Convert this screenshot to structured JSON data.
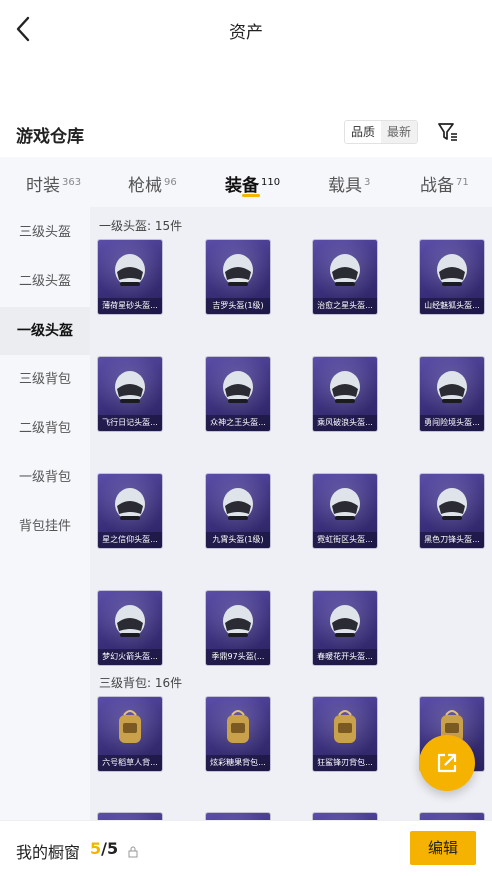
{
  "header": {
    "title": "资产"
  },
  "warehouse": {
    "title": "游戏仓库",
    "sort_options": [
      "品质",
      "最新"
    ]
  },
  "tabs": [
    {
      "label": "时装",
      "count": "363"
    },
    {
      "label": "枪械",
      "count": "96"
    },
    {
      "label": "装备",
      "count": "110"
    },
    {
      "label": "载具",
      "count": "3"
    },
    {
      "label": "战备",
      "count": "71"
    }
  ],
  "sidebar": [
    "三级头盔",
    "二级头盔",
    "一级头盔",
    "三级背包",
    "二级背包",
    "一级背包",
    "背包挂件"
  ],
  "groups": [
    {
      "label": "一级头盔: 15件",
      "items": [
        "薄荷星砂头盔...",
        "吉罗头盔(1级)",
        "治愈之星头盔...",
        "山经魅狐头盔...",
        "飞行日记头盔...",
        "众神之王头盔...",
        "乘风破浪头盔...",
        "勇闯险境头盔...",
        "星之信仰头盔...",
        "九霄头盔(1级)",
        "霓虹街区头盔...",
        "黑色刀锋头盔...",
        "梦幻火箭头盔...",
        "季鼎97头盔(...",
        "春暖花开头盔..."
      ]
    },
    {
      "label": "三级背包: 16件",
      "items": [
        "六号稻草人背...",
        "炫彩糖果背包...",
        "狂鲨锋刃背包...",
        ""
      ]
    }
  ],
  "bottom": {
    "showcase_label": "我的橱窗",
    "current": "5",
    "total": "/5",
    "edit_label": "编辑"
  },
  "colors": {
    "accent": "#f6b200",
    "card": "#3a2f7a"
  }
}
